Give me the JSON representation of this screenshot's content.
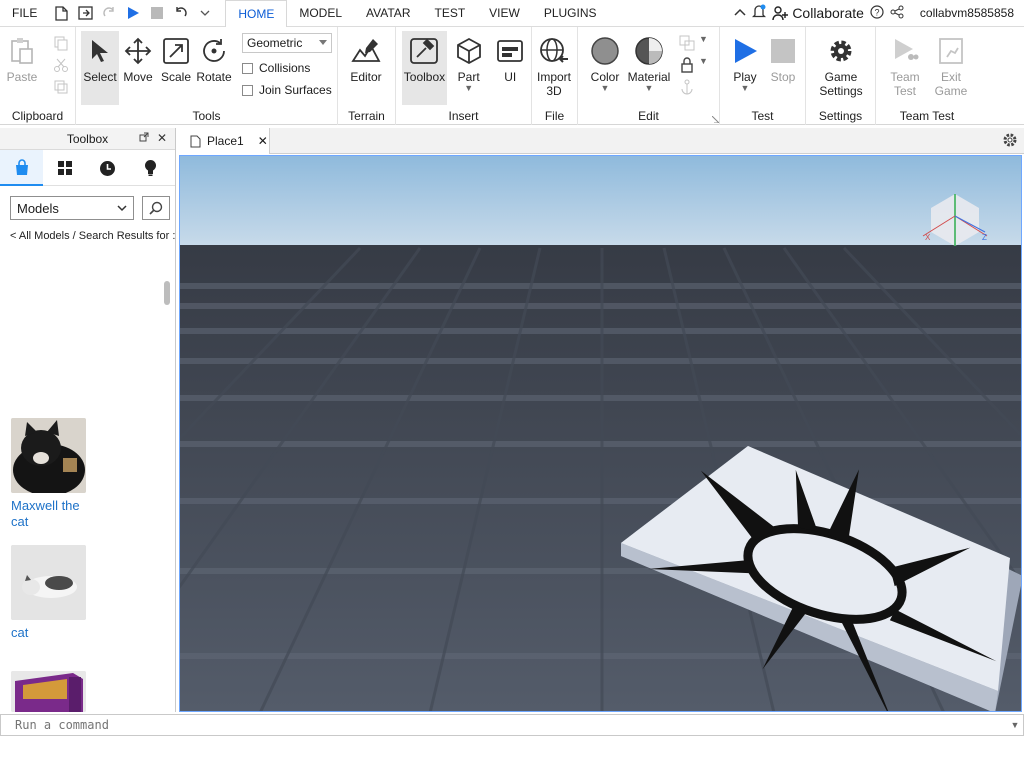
{
  "menubar": {
    "file": "FILE",
    "tabs": [
      "HOME",
      "MODEL",
      "AVATAR",
      "TEST",
      "VIEW",
      "PLUGINS"
    ],
    "active_tab": "HOME",
    "collaborate": "Collaborate",
    "username": "collabvm8585858"
  },
  "ribbon": {
    "clipboard": {
      "label": "Clipboard",
      "paste": "Paste"
    },
    "tools": {
      "label": "Tools",
      "select": "Select",
      "move": "Move",
      "scale": "Scale",
      "rotate": "Rotate",
      "mode": "Geometric",
      "collisions": "Collisions",
      "join_surfaces": "Join Surfaces"
    },
    "terrain": {
      "label": "Terrain",
      "editor": "Editor"
    },
    "insert": {
      "label": "Insert",
      "toolbox": "Toolbox",
      "part": "Part",
      "ui": "UI"
    },
    "file": {
      "label": "File",
      "import3d": "Import\n3D"
    },
    "edit": {
      "label": "Edit",
      "color": "Color",
      "material": "Material"
    },
    "test": {
      "label": "Test",
      "play": "Play",
      "stop": "Stop"
    },
    "settings": {
      "label": "Settings",
      "game_settings": "Game\nSettings"
    },
    "team_test": {
      "label": "Team Test",
      "team_test_btn": "Team\nTest",
      "exit_game": "Exit\nGame"
    }
  },
  "toolbox": {
    "title": "Toolbox",
    "category": "Models",
    "breadcrumb": "< All Models / Search Results for :",
    "models": [
      {
        "name": "Maxwell the cat"
      },
      {
        "name": "cat"
      },
      {
        "name": ""
      }
    ]
  },
  "document": {
    "tab": "Place1"
  },
  "command": {
    "placeholder": "Run a command"
  },
  "colors": {
    "accent": "#0b5cd6",
    "play": "#1f6fe5",
    "link": "#1e72c8",
    "sky_top": "#8fbadc",
    "baseplate": "#4d5563"
  }
}
